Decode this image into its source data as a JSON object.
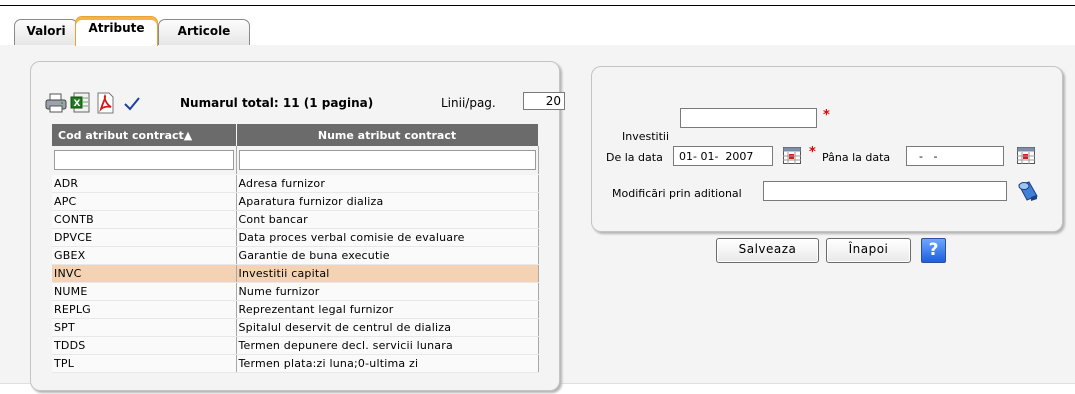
{
  "tabs": [
    {
      "label": "Valori"
    },
    {
      "label": "Atribute"
    },
    {
      "label": "Articole"
    }
  ],
  "toolbar": {
    "total_text": "Numarul total: 11 (1 pagina)",
    "rows_label": "Linii/pag.",
    "rows_value": "20"
  },
  "grid": {
    "columns": [
      "Cod atribut contract",
      "Nume atribut contract"
    ],
    "sort_indicator": "▲",
    "rows": [
      {
        "code": "ADR",
        "name": "Adresa furnizor"
      },
      {
        "code": "APC",
        "name": "Aparatura furnizor dializa"
      },
      {
        "code": "CONTB",
        "name": "Cont bancar"
      },
      {
        "code": "DPVCE",
        "name": "Data proces verbal comisie de evaluare"
      },
      {
        "code": "GBEX",
        "name": "Garantie de buna executie"
      },
      {
        "code": "INVC",
        "name": "Investitii capital"
      },
      {
        "code": "NUME",
        "name": "Nume furnizor"
      },
      {
        "code": "REPLG",
        "name": "Reprezentant legal furnizor"
      },
      {
        "code": "SPT",
        "name": "Spitalul deservit de centrul de dializa"
      },
      {
        "code": "TDDS",
        "name": "Termen depunere decl. servicii lunara"
      },
      {
        "code": "TPL",
        "name": "Termen plata:zi luna;0-ultima zi"
      }
    ],
    "selected_code": "INVC"
  },
  "form": {
    "investitii_label": "Investitii",
    "investitii_value": "",
    "de_la_label": "De la data",
    "de_la_value": "01- 01-  2007",
    "pana_la_label": "Pâna la data",
    "pana_la_value": "  -   -",
    "modificari_label": "Modificări prin aditional",
    "modificari_value": "",
    "required_mark": "*"
  },
  "buttons": {
    "save": "Salveaza",
    "back": "Înapoi",
    "help": "?"
  },
  "colors": {
    "active_tab_accent": "#f3b548",
    "grid_header": "#6b6b6b",
    "selected_row": "#f3d3b3",
    "required": "#e00000"
  },
  "icons": [
    "printer-icon",
    "excel-icon",
    "pdf-icon",
    "checkmark-icon",
    "calendar-icon",
    "search-icon",
    "help-icon"
  ]
}
